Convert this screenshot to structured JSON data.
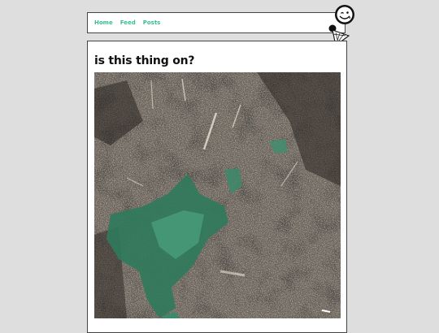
{
  "nav": {
    "links": [
      "Home",
      "Feed",
      "Posts"
    ]
  },
  "post": {
    "title": "is this thing on?",
    "image": "cracked-concrete-photo"
  },
  "colors": {
    "link": "#3bbd8e",
    "background": "#dedede"
  },
  "icons": {
    "logo": "smiley-ice-cream-logo"
  }
}
